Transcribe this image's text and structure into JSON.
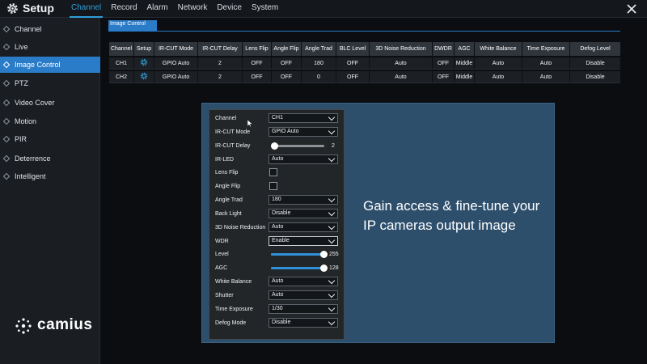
{
  "app": {
    "title": "Setup"
  },
  "menu": [
    "Channel",
    "Record",
    "Alarm",
    "Network",
    "Device",
    "System"
  ],
  "menu_active": "Channel",
  "sidebar": {
    "items": [
      {
        "label": "Channel"
      },
      {
        "label": "Live"
      },
      {
        "label": "Image Control"
      },
      {
        "label": "PTZ"
      },
      {
        "label": "Video Cover"
      },
      {
        "label": "Motion"
      },
      {
        "label": "PIR"
      },
      {
        "label": "Deterrence"
      },
      {
        "label": "Intelligent"
      }
    ],
    "active": "Image Control"
  },
  "brand": "camius",
  "subtab": "Image Control",
  "table": {
    "headers": [
      "Channel",
      "Setup",
      "IR-CUT Mode",
      "IR-CUT Delay",
      "Lens Flip",
      "Angle Flip",
      "Angle Trad",
      "BLC Level",
      "3D Noise Reduction",
      "DWDR",
      "AGC",
      "White Balance",
      "Time Exposure",
      "Defog Level"
    ],
    "rows": [
      [
        "CH1",
        "",
        "GPIO Auto",
        "2",
        "OFF",
        "OFF",
        "180",
        "OFF",
        "Auto",
        "OFF",
        "Middle",
        "Auto",
        "Auto",
        "Disable"
      ],
      [
        "CH2",
        "",
        "GPIO Auto",
        "2",
        "OFF",
        "OFF",
        "0",
        "OFF",
        "Auto",
        "OFF",
        "Middle",
        "Auto",
        "Auto",
        "Disable"
      ]
    ]
  },
  "form": {
    "channel": {
      "label": "Channel",
      "value": "CH1"
    },
    "ircut_mode": {
      "label": "IR-CUT Mode",
      "value": "GPIO Auto"
    },
    "ircut_delay": {
      "label": "IR-CUT Delay",
      "value": "2",
      "level": 0.07
    },
    "ir_led": {
      "label": "IR-LED",
      "value": "Auto"
    },
    "lens_flip": {
      "label": "Lens Flip",
      "checked": false
    },
    "angle_flip": {
      "label": "Angle Flip",
      "checked": false
    },
    "angle_trad": {
      "label": "Angle Trad",
      "value": "180"
    },
    "back_light": {
      "label": "Back Light",
      "value": "Disable"
    },
    "noise_reduction": {
      "label": "3D Noise Reduction",
      "value": "Auto"
    },
    "wdr": {
      "label": "WDR",
      "value": "Enable"
    },
    "level": {
      "label": "Level",
      "value": "255",
      "level": 1.0
    },
    "agc": {
      "label": "AGC",
      "value": "128",
      "level": 1.0
    },
    "white_balance": {
      "label": "White Balance",
      "value": "Auto"
    },
    "shutter": {
      "label": "Shutter",
      "value": "Auto"
    },
    "time_exposure": {
      "label": "Time Exposure",
      "value": "1/30"
    },
    "defog_mode": {
      "label": "Defog Mode",
      "value": "Disable"
    }
  },
  "overlay": {
    "line1": "Gain access & fine-tune your",
    "line2": "IP cameras output image"
  },
  "icons": {
    "setup": "gear-icon",
    "close": "close-icon",
    "channel_setup": "gear-icon",
    "dropdown": "chevron-down-icon"
  },
  "colors": {
    "accent": "#2b7cc8",
    "menu_active": "#2f9fd8",
    "overlay_bg": "#2d4f6c"
  }
}
